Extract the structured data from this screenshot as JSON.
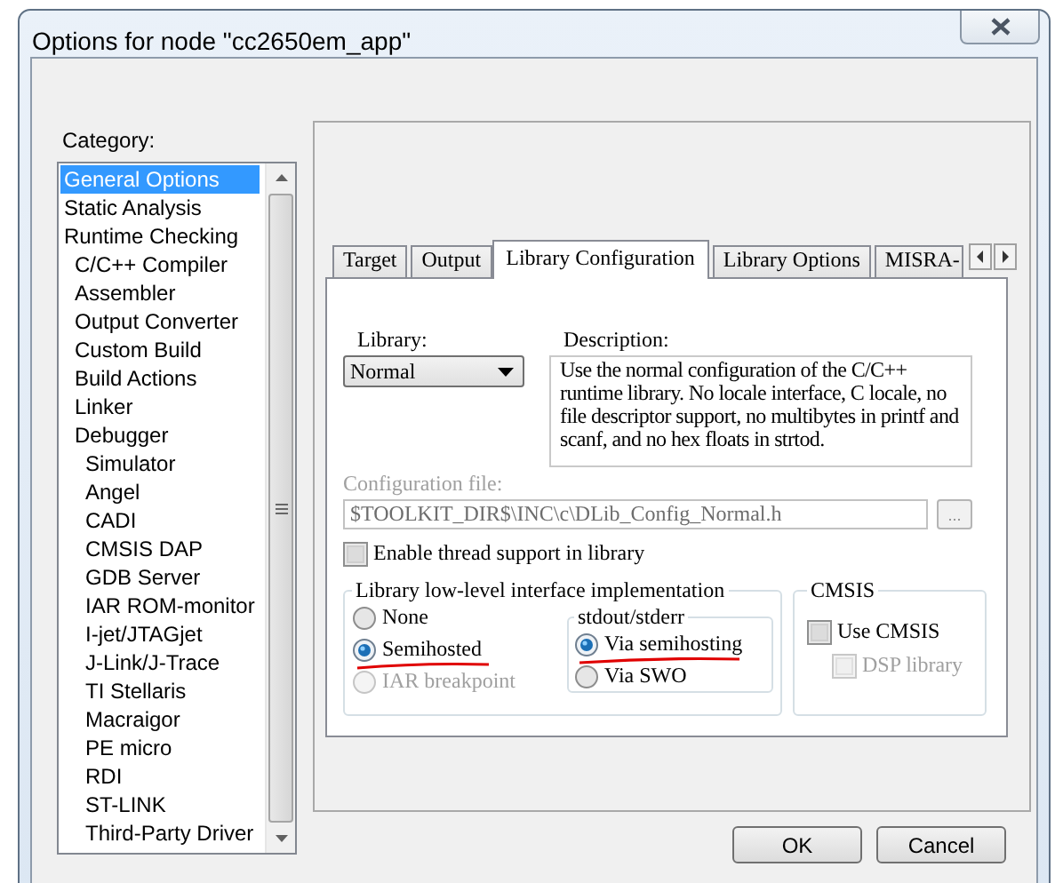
{
  "window": {
    "title": "Options for node \"cc2650em_app\""
  },
  "category": {
    "label": "Category:",
    "items": [
      {
        "label": "General Options",
        "selected": true
      },
      {
        "label": "Static Analysis",
        "selected": false
      },
      {
        "label": "Runtime Checking",
        "selected": false,
        "children": [
          {
            "label": "C/C++ Compiler",
            "selected": false
          },
          {
            "label": "Assembler",
            "selected": false
          },
          {
            "label": "Output Converter",
            "selected": false
          },
          {
            "label": "Custom Build",
            "selected": false
          },
          {
            "label": "Build Actions",
            "selected": false
          },
          {
            "label": "Linker",
            "selected": false
          },
          {
            "label": "Debugger",
            "selected": false,
            "children": [
              {
                "label": "Simulator",
                "selected": false
              },
              {
                "label": "Angel",
                "selected": false
              },
              {
                "label": "CADI",
                "selected": false
              },
              {
                "label": "CMSIS DAP",
                "selected": false
              },
              {
                "label": "GDB Server",
                "selected": false
              },
              {
                "label": "IAR ROM-monitor",
                "selected": false
              },
              {
                "label": "I-jet/JTAGjet",
                "selected": false
              },
              {
                "label": "J-Link/J-Trace",
                "selected": false
              },
              {
                "label": "TI Stellaris",
                "selected": false
              },
              {
                "label": "Macraigor",
                "selected": false
              },
              {
                "label": "PE micro",
                "selected": false
              },
              {
                "label": "RDI",
                "selected": false
              },
              {
                "label": "ST-LINK",
                "selected": false
              },
              {
                "label": "Third-Party Driver",
                "selected": false
              }
            ]
          }
        ]
      }
    ]
  },
  "tabs": [
    {
      "label": "Target",
      "selected": false
    },
    {
      "label": "Output",
      "selected": false
    },
    {
      "label": "Library Configuration",
      "selected": true
    },
    {
      "label": "Library Options",
      "selected": false
    },
    {
      "label": "MISRA-",
      "selected": false
    }
  ],
  "library": {
    "label": "Library:",
    "value": "Normal"
  },
  "description": {
    "label": "Description:",
    "text": "Use the normal configuration of the C/C++ runtime library. No locale interface, C locale, no file descriptor support, no multibytes in printf and scanf, and no hex floats in strtod."
  },
  "config_file": {
    "label": "Configuration file:",
    "value": "$TOOLKIT_DIR$\\INC\\c\\DLib_Config_Normal.h",
    "disabled": true,
    "browse": "..."
  },
  "thread_support": {
    "label": "Enable thread support in library",
    "checked": false
  },
  "low_level": {
    "title": "Library low-level interface implementation",
    "options": [
      {
        "label": "None",
        "selected": false,
        "disabled": false,
        "underlined": false
      },
      {
        "label": "Semihosted",
        "selected": true,
        "disabled": false,
        "underlined": true
      },
      {
        "label": "IAR breakpoint",
        "selected": false,
        "disabled": true,
        "underlined": false
      }
    ],
    "stdout": {
      "title": "stdout/stderr",
      "options": [
        {
          "label": "Via semihosting",
          "selected": true,
          "disabled": false,
          "underlined": true
        },
        {
          "label": "Via SWO",
          "selected": false,
          "disabled": false,
          "underlined": false
        }
      ]
    }
  },
  "cmsis": {
    "title": "CMSIS",
    "options": [
      {
        "label": "Use CMSIS",
        "checked": false,
        "disabled": false
      },
      {
        "label": "DSP library",
        "checked": false,
        "disabled": true
      }
    ]
  },
  "buttons": [
    {
      "label": "OK"
    },
    {
      "label": "Cancel"
    }
  ]
}
